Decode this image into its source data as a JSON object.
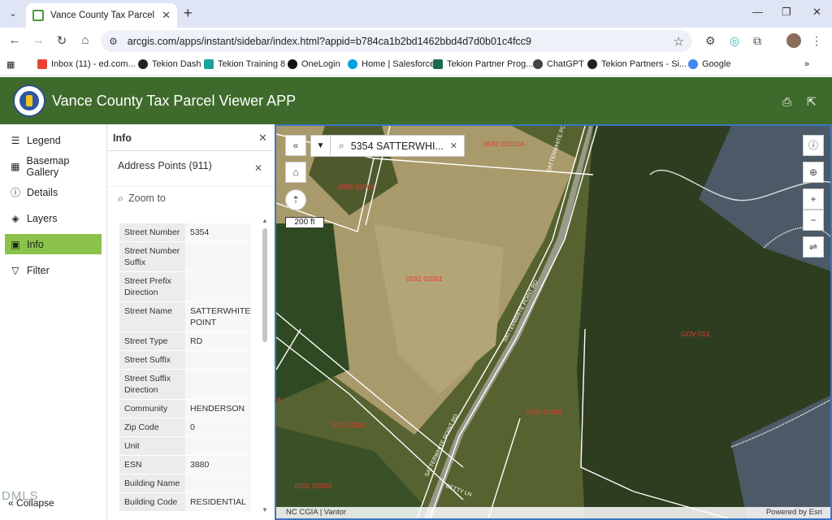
{
  "browser": {
    "tab_title": "Vance County Tax Parcel Viewer",
    "url": "arcgis.com/apps/instant/sidebar/index.html?appid=b784ca1b2bd1462bbd4d7d0b01c4fcc9",
    "bookmarks": [
      "Inbox (11) - ed.com...",
      "Tekion Dash",
      "Tekion Training 8",
      "OneLogin",
      "Home | Salesforce",
      "Tekion Partner Prog...",
      "ChatGPT",
      "Tekion Partners - Si...",
      "Google"
    ]
  },
  "app": {
    "title": "Vance County Tax Parcel Viewer APP"
  },
  "sidebar": {
    "items": [
      "Legend",
      "Basemap Gallery",
      "Details",
      "Layers",
      "Info",
      "Filter"
    ],
    "active": "Info",
    "collapse_label": "Collapse",
    "watermark": "DMLS"
  },
  "panel": {
    "title": "Info",
    "section_title": "Address Points (911)",
    "zoom_label": "Zoom to",
    "attributes": [
      {
        "k": "Street Number",
        "v": "5354"
      },
      {
        "k": "Street Number Suffix",
        "v": ""
      },
      {
        "k": "Street Prefix Direction",
        "v": ""
      },
      {
        "k": "Street Name",
        "v": "SATTERWHITE POINT"
      },
      {
        "k": "Street Type",
        "v": "RD"
      },
      {
        "k": "Street Suffix",
        "v": ""
      },
      {
        "k": "Street Suffix Direction",
        "v": ""
      },
      {
        "k": "Community",
        "v": "HENDERSON"
      },
      {
        "k": "Zip Code",
        "v": "0"
      },
      {
        "k": "Unit",
        "v": ""
      },
      {
        "k": "ESN",
        "v": "3880"
      },
      {
        "k": "Building Name",
        "v": ""
      },
      {
        "k": "Building Code",
        "v": "RESIDENTIAL"
      }
    ]
  },
  "map": {
    "search_text": "5354 SATTERWHI...",
    "scale": "200 ft",
    "parcels": [
      "0592 02001A",
      "0592 02003",
      "0592 02001",
      "GOV-012",
      "0592 01001",
      "0591 02041",
      "0591 02003",
      "8"
    ],
    "roads": [
      "SATTERWHITE POINT RD",
      "SATTERWHITE POINT RD",
      "SATTERWHITE POINT RD",
      "BETTY LN"
    ],
    "attribution_left": "NC CGIA | Vantor",
    "attribution_right": "Powered by Esri"
  }
}
